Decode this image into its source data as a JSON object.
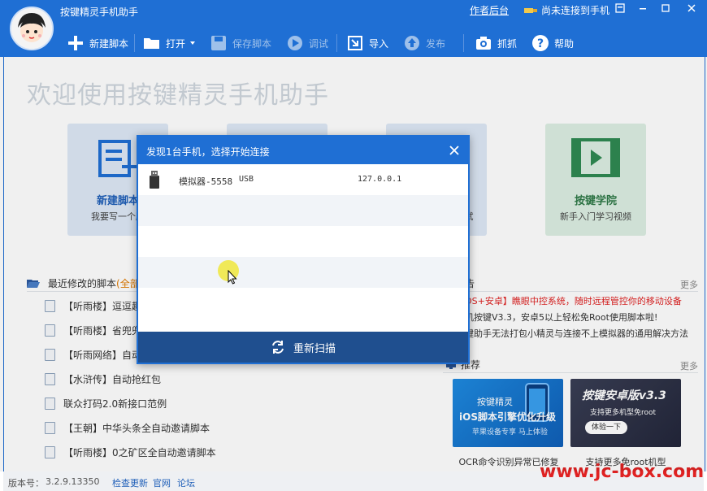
{
  "app": {
    "title": "按键精灵手机助手",
    "author_backend": "作者后台",
    "connection_status": "尚未连接到手机"
  },
  "toolbar": {
    "new_script": "新建脚本",
    "open": "打开",
    "save": "保存脚本",
    "debug": "调试",
    "import": "导入",
    "publish": "发布",
    "capture": "抓抓",
    "help": "帮助"
  },
  "welcome": "欢迎使用按键精灵手机助手",
  "cards": {
    "new_script": {
      "title": "新建脚本",
      "subtitle": "我要写一个脚"
    },
    "middle_subtitle": "试",
    "academy": {
      "title": "按键学院",
      "subtitle": "新手入门学习视频"
    }
  },
  "recent": {
    "title": "最近修改的脚本",
    "all_link": "(全部打",
    "items": [
      "【听雨楼】逗逗趣玩",
      "【听雨楼】省兜兜全",
      "【听雨网络】自动抢",
      "【水浒传】自动抢红包",
      "联众打码2.0新接口范例",
      "【王朝】中华头条全自动邀请脚本",
      "【听雨楼】0之矿区全自动邀请脚本"
    ]
  },
  "notice": {
    "title": "告",
    "more": "更多",
    "items": [
      {
        "prefix": "OS+安卓】",
        "text": "瞧眼中控系统，随时远程管控你的移动设备"
      },
      {
        "prefix": "",
        "text": "机按键V3.3，安卓5以上轻松免Root使用脚本啦!"
      },
      {
        "prefix": "",
        "text": "键助手无法打包小精灵与连接不上模拟器的通用解决方法"
      }
    ]
  },
  "recommend": {
    "title": "推荐",
    "more": "更多",
    "banner1": {
      "brand": "按键精灵",
      "headline": "iOS脚本引擎优化升级",
      "tagline": "苹果设备专享 马上体验",
      "caption": "OCR命令识别异常已修复"
    },
    "banner2": {
      "headline": "按键安卓版v3.3",
      "tagline": "支持更多机型免root",
      "cta": "体验一下",
      "caption": "支持更多免root机型"
    }
  },
  "status": {
    "version_label": "版本号：",
    "version": "3.2.9.13350",
    "check_update": "检查更新",
    "website": "官网",
    "forum": "论坛"
  },
  "watermark": "www.jc-box.com",
  "dialog": {
    "title": "发现1台手机，选择开始连接",
    "device": {
      "name": "模拟器-5558",
      "type": "USB",
      "ip": "127.0.0.1"
    },
    "rescan": "重新扫描"
  },
  "colors": {
    "primary": "#1f6fd4",
    "dialog_footer": "#1f4f8f",
    "card_blue": "#dde8f6",
    "card_green": "#dcefe3",
    "link": "#1f5fb8",
    "alert": "#e02222"
  }
}
